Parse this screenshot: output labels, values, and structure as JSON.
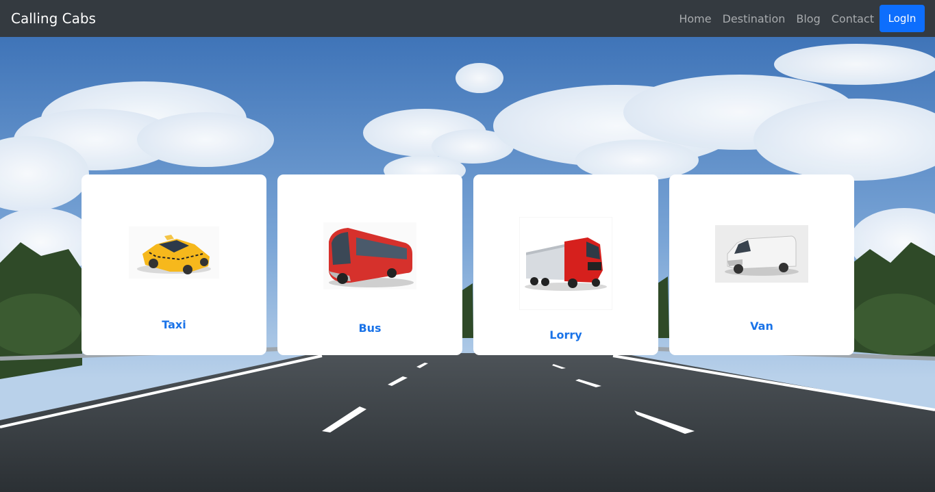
{
  "navbar": {
    "brand": "Calling Cabs",
    "links": [
      "Home",
      "Destination",
      "Blog",
      "Contact"
    ],
    "login_label": "LogIn"
  },
  "cards": [
    {
      "label": "Taxi",
      "icon": "taxi-icon"
    },
    {
      "label": "Bus",
      "icon": "bus-icon"
    },
    {
      "label": "Lorry",
      "icon": "lorry-icon"
    },
    {
      "label": "Van",
      "icon": "van-icon"
    }
  ],
  "colors": {
    "navbar_bg": "#343a40",
    "login_bg": "#0d6efd",
    "card_label": "#1a73e8"
  }
}
